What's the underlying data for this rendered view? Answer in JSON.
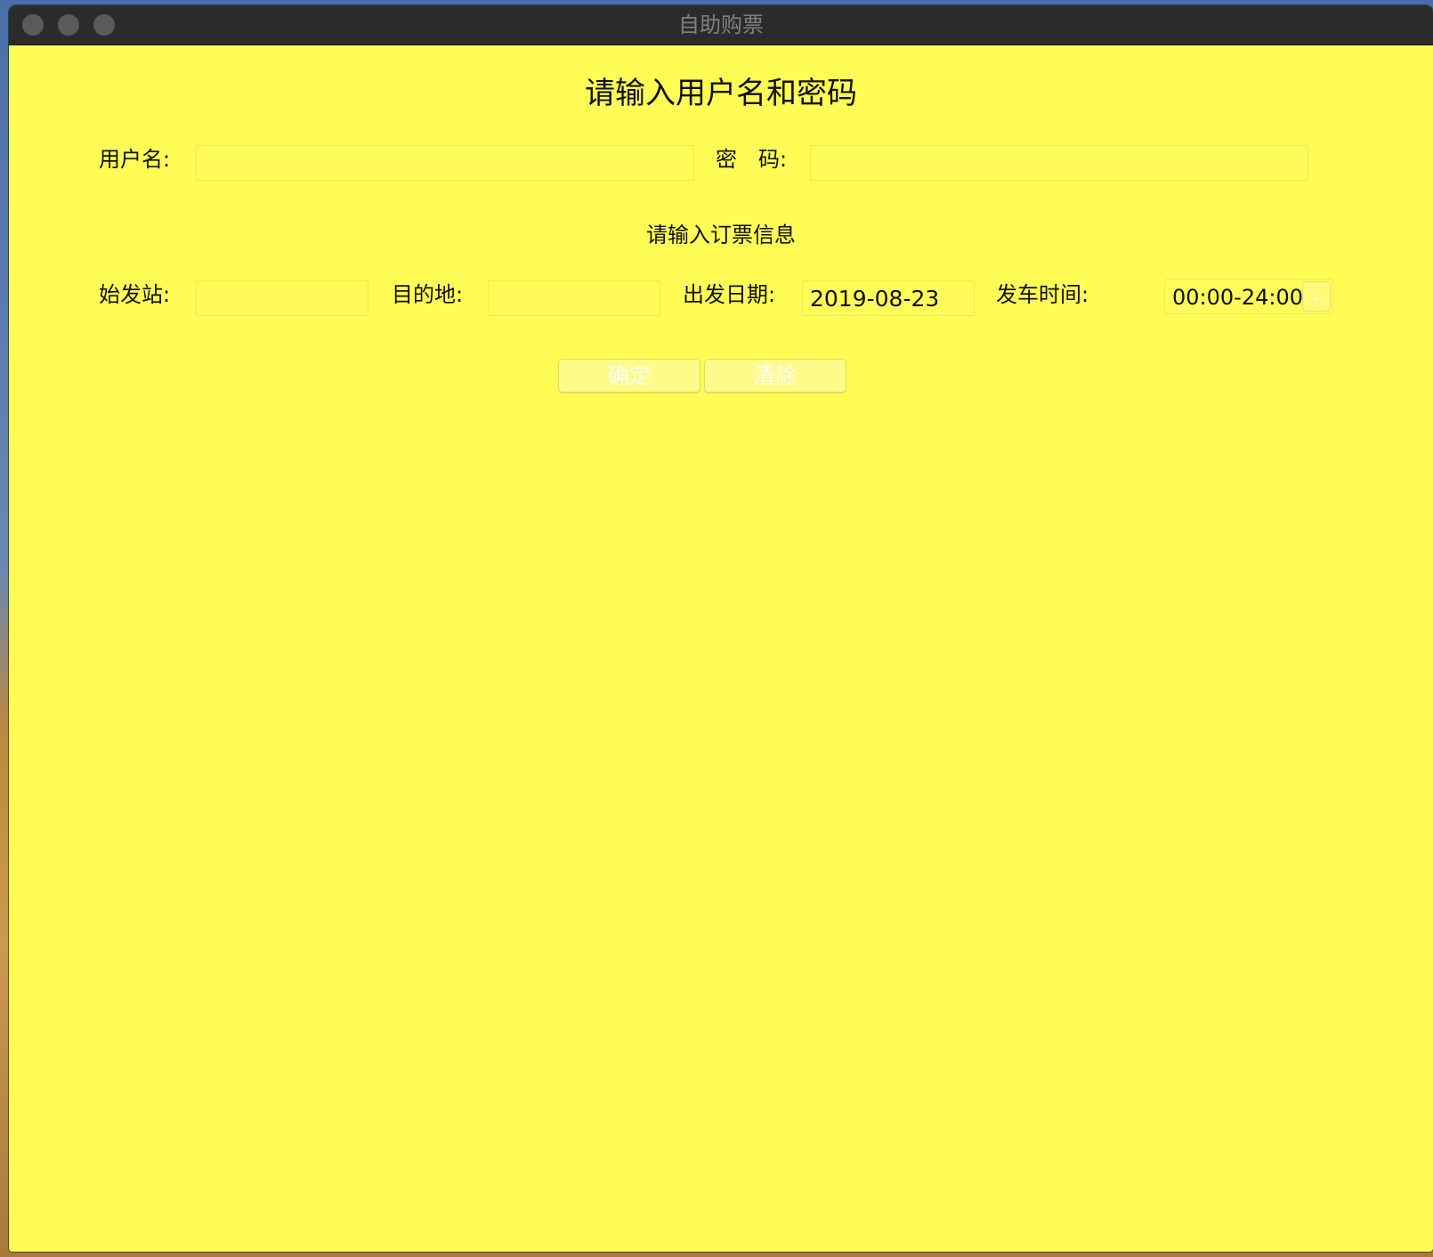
{
  "window": {
    "title": "自助购票"
  },
  "login": {
    "heading": "请输入用户名和密码",
    "username_label": "用户名:",
    "username_value": "",
    "password_label": "密　码:",
    "password_value": ""
  },
  "booking": {
    "heading": "请输入订票信息",
    "origin_label": "始发站:",
    "origin_value": "",
    "destination_label": "目的地:",
    "destination_value": "",
    "date_label": "出发日期:",
    "date_value": "2019-08-23",
    "time_label": "发车时间:",
    "time_value": "00:00-24:00"
  },
  "actions": {
    "confirm_label": "确定",
    "clear_label": "清除"
  },
  "colors": {
    "background": "#fffc55",
    "titlebar": "#2b2b2b"
  }
}
